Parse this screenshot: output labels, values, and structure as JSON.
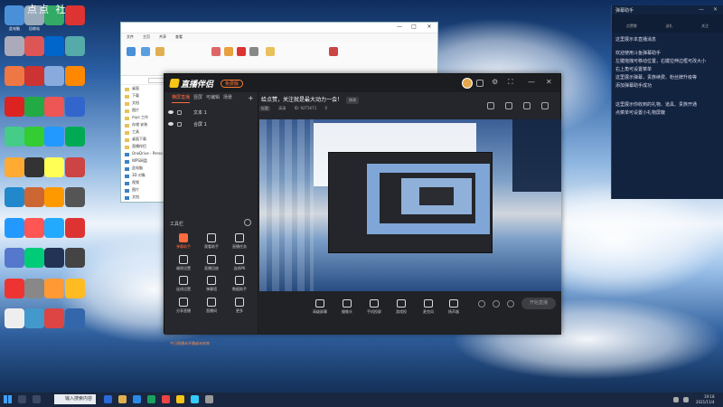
{
  "desktop": {
    "overlay_title": "点点 社",
    "overlay_title2": "T",
    "icons": [
      {
        "label": "此电脑",
        "color": "#4a90d9"
      },
      {
        "label": "回收站",
        "color": "#9ab"
      },
      {
        "label": "",
        "color": "#3a6"
      },
      {
        "label": "",
        "color": "#d33"
      },
      {
        "label": "",
        "color": "#aab"
      },
      {
        "label": "",
        "color": "#d55"
      },
      {
        "label": "",
        "color": "#06c"
      },
      {
        "label": "",
        "color": "#5aa"
      },
      {
        "label": "",
        "color": "#e74"
      },
      {
        "label": "",
        "color": "#c33"
      },
      {
        "label": "",
        "color": "#8ad"
      },
      {
        "label": "",
        "color": "#f80"
      },
      {
        "label": "",
        "color": "#d22"
      },
      {
        "label": "",
        "color": "#2a4"
      },
      {
        "label": "",
        "color": "#e55"
      },
      {
        "label": "",
        "color": "#36c"
      },
      {
        "label": "",
        "color": "#4c8"
      },
      {
        "label": "",
        "color": "#3c3"
      },
      {
        "label": "",
        "color": "#29f"
      },
      {
        "label": "",
        "color": "#0a5"
      },
      {
        "label": "",
        "color": "#fa3"
      },
      {
        "label": "",
        "color": "#333"
      },
      {
        "label": "",
        "color": "#ff5"
      },
      {
        "label": "",
        "color": "#c44"
      },
      {
        "label": "",
        "color": "#28c"
      },
      {
        "label": "",
        "color": "#c63"
      },
      {
        "label": "",
        "color": "#f90"
      },
      {
        "label": "",
        "color": "#555"
      },
      {
        "label": "",
        "color": "#29f"
      },
      {
        "label": "",
        "color": "#f55"
      },
      {
        "label": "",
        "color": "#2af"
      },
      {
        "label": "",
        "color": "#d33"
      },
      {
        "label": "",
        "color": "#57c"
      },
      {
        "label": "",
        "color": "#0c7"
      },
      {
        "label": "",
        "color": "#235"
      },
      {
        "label": "",
        "color": "#444"
      },
      {
        "label": "",
        "color": "#e33"
      },
      {
        "label": "",
        "color": "#888"
      },
      {
        "label": "",
        "color": "#f93"
      },
      {
        "label": "",
        "color": "#fb2"
      },
      {
        "label": "",
        "color": "#eee"
      },
      {
        "label": "",
        "color": "#49c"
      },
      {
        "label": "",
        "color": "#d44"
      },
      {
        "label": "",
        "color": "#36a"
      }
    ]
  },
  "explorer": {
    "tabs": [
      "文件",
      "主页",
      "共享",
      "查看"
    ],
    "sidebar": [
      "桌面",
      "下载",
      "文档",
      "图片",
      "myo 工作",
      "存储 安装",
      "工具",
      "桌面下载",
      "直播伴侣",
      "OneDrive - Perso",
      "WPS网盘",
      "此电脑",
      "3D 对象",
      "视频",
      "图片",
      "文档"
    ],
    "minimize": "—",
    "maximize": "□",
    "close": "✕"
  },
  "app": {
    "name": "直播伴侣",
    "free_badge": "免费版",
    "left_tabs": [
      "横屏直播",
      "竖屏",
      "可编辑",
      "场景"
    ],
    "plus": "+",
    "scenes": [
      {
        "label": "文本 1"
      },
      {
        "label": "合屏 1"
      }
    ],
    "tools_title": "工具栏",
    "tools": [
      {
        "label": "弹幕助手",
        "hot": true
      },
      {
        "label": "观看助手",
        "hot": false
      },
      {
        "label": "直播任务",
        "hot": false
      },
      {
        "label": "福袋设置",
        "hot": false
      },
      {
        "label": "直播回放",
        "hot": false
      },
      {
        "label": "连线PK",
        "hot": false
      },
      {
        "label": "连线设置",
        "hot": false
      },
      {
        "label": "弹幕墙",
        "hot": false
      },
      {
        "label": "数据助手",
        "hot": false
      },
      {
        "label": "分享直播",
        "hot": false
      },
      {
        "label": "直播间",
        "hot": false
      },
      {
        "label": "更多",
        "hot": false
      }
    ],
    "bottom_note": "今日直播未开播或未结束",
    "stream_title": "给点赞，关注就是最大动力一会！",
    "report": "修改",
    "info": {
      "tag": "标题",
      "quality": "高清",
      "id": "ID: 92T5K71",
      "likes": "0"
    },
    "controls": [
      {
        "label": "高级屏幕"
      },
      {
        "label": "摄像头"
      },
      {
        "label": "手机投屏"
      },
      {
        "label": "游戏投"
      },
      {
        "label": "麦克风"
      },
      {
        "label": "扬声器"
      }
    ],
    "start_button": "开始直播",
    "win_controls": [
      "⚙",
      "⛶",
      "—",
      "✕"
    ]
  },
  "chat": {
    "title": "弹幕助手",
    "stats": [
      {
        "label": "点赞数"
      },
      {
        "label": "送礼"
      },
      {
        "label": "关注"
      }
    ],
    "messages": [
      "这里展示本直播消息",
      "",
      "欢迎使用斗鱼弹幕助手",
      "左键拖拽可移动位置，右键拉伸边框可改大小",
      "右上角可设置菜单",
      "这里展示弹幕，贵族续费、粉丝牌升级等",
      "添加弹幕助手成功",
      "",
      "",
      "这里展示你收到的礼物、道具、贵族开通",
      "点菜单可设置小礼物屏蔽"
    ],
    "win": [
      "—",
      "✕"
    ]
  },
  "taskbar": {
    "search": "输入搜索内容",
    "clock_time": "19:18",
    "clock_date": "2021/11/4"
  }
}
